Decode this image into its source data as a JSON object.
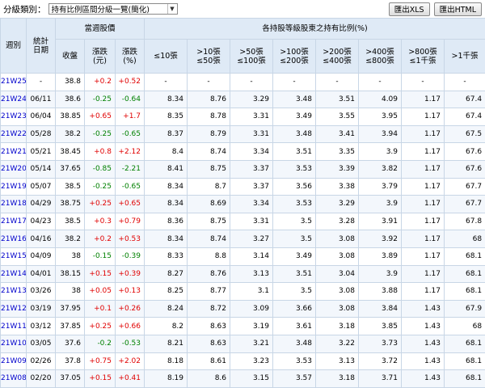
{
  "toolbar": {
    "category_label": "分級類別：",
    "category_value": "持有比例區間分級一覽(簡化)",
    "export_xls": "匯出XLS",
    "export_html": "匯出HTML"
  },
  "table": {
    "headers": {
      "week": "週別",
      "date": "統計\n日期",
      "price_group": "當週股價",
      "close": "收盤",
      "change": "漲跌\n(元)",
      "change_pct": "漲跌\n(%)",
      "holders_group": "各持股等級股東之持有比例(%)",
      "levels": [
        "≤10張",
        ">10張\n≤50張",
        ">50張\n≤100張",
        ">100張\n≤200張",
        ">200張\n≤400張",
        ">400張\n≤800張",
        ">800張\n≤1千張",
        ">1千張"
      ]
    },
    "rows": [
      {
        "week": "21W25",
        "date": "-",
        "close": "38.8",
        "change": "+0.2",
        "pct": "+0.52",
        "dir": "up",
        "levels": [
          "-",
          "-",
          "-",
          "-",
          "-",
          "-",
          "-",
          "-"
        ]
      },
      {
        "week": "21W24",
        "date": "06/11",
        "close": "38.6",
        "change": "-0.25",
        "pct": "-0.64",
        "dir": "dn",
        "levels": [
          "8.34",
          "8.76",
          "3.29",
          "3.48",
          "3.51",
          "4.09",
          "1.17",
          "67.4"
        ]
      },
      {
        "week": "21W23",
        "date": "06/04",
        "close": "38.85",
        "change": "+0.65",
        "pct": "+1.7",
        "dir": "up",
        "levels": [
          "8.35",
          "8.78",
          "3.31",
          "3.49",
          "3.55",
          "3.95",
          "1.17",
          "67.4"
        ]
      },
      {
        "week": "21W22",
        "date": "05/28",
        "close": "38.2",
        "change": "-0.25",
        "pct": "-0.65",
        "dir": "dn",
        "levels": [
          "8.37",
          "8.79",
          "3.31",
          "3.48",
          "3.41",
          "3.94",
          "1.17",
          "67.5"
        ]
      },
      {
        "week": "21W21",
        "date": "05/21",
        "close": "38.45",
        "change": "+0.8",
        "pct": "+2.12",
        "dir": "up",
        "levels": [
          "8.4",
          "8.74",
          "3.34",
          "3.51",
          "3.35",
          "3.9",
          "1.17",
          "67.6"
        ]
      },
      {
        "week": "21W20",
        "date": "05/14",
        "close": "37.65",
        "change": "-0.85",
        "pct": "-2.21",
        "dir": "dn",
        "levels": [
          "8.41",
          "8.75",
          "3.37",
          "3.53",
          "3.39",
          "3.82",
          "1.17",
          "67.6"
        ]
      },
      {
        "week": "21W19",
        "date": "05/07",
        "close": "38.5",
        "change": "-0.25",
        "pct": "-0.65",
        "dir": "dn",
        "levels": [
          "8.34",
          "8.7",
          "3.37",
          "3.56",
          "3.38",
          "3.79",
          "1.17",
          "67.7"
        ]
      },
      {
        "week": "21W18",
        "date": "04/29",
        "close": "38.75",
        "change": "+0.25",
        "pct": "+0.65",
        "dir": "up",
        "levels": [
          "8.34",
          "8.69",
          "3.34",
          "3.53",
          "3.29",
          "3.9",
          "1.17",
          "67.7"
        ]
      },
      {
        "week": "21W17",
        "date": "04/23",
        "close": "38.5",
        "change": "+0.3",
        "pct": "+0.79",
        "dir": "up",
        "levels": [
          "8.36",
          "8.75",
          "3.31",
          "3.5",
          "3.28",
          "3.91",
          "1.17",
          "67.8"
        ]
      },
      {
        "week": "21W16",
        "date": "04/16",
        "close": "38.2",
        "change": "+0.2",
        "pct": "+0.53",
        "dir": "up",
        "levels": [
          "8.34",
          "8.74",
          "3.27",
          "3.5",
          "3.08",
          "3.92",
          "1.17",
          "68"
        ]
      },
      {
        "week": "21W15",
        "date": "04/09",
        "close": "38",
        "change": "-0.15",
        "pct": "-0.39",
        "dir": "dn",
        "levels": [
          "8.33",
          "8.8",
          "3.14",
          "3.49",
          "3.08",
          "3.89",
          "1.17",
          "68.1"
        ]
      },
      {
        "week": "21W14",
        "date": "04/01",
        "close": "38.15",
        "change": "+0.15",
        "pct": "+0.39",
        "dir": "up",
        "levels": [
          "8.27",
          "8.76",
          "3.13",
          "3.51",
          "3.04",
          "3.9",
          "1.17",
          "68.1"
        ]
      },
      {
        "week": "21W13",
        "date": "03/26",
        "close": "38",
        "change": "+0.05",
        "pct": "+0.13",
        "dir": "up",
        "levels": [
          "8.25",
          "8.77",
          "3.1",
          "3.5",
          "3.08",
          "3.88",
          "1.17",
          "68.1"
        ]
      },
      {
        "week": "21W12",
        "date": "03/19",
        "close": "37.95",
        "change": "+0.1",
        "pct": "+0.26",
        "dir": "up",
        "levels": [
          "8.24",
          "8.72",
          "3.09",
          "3.66",
          "3.08",
          "3.84",
          "1.43",
          "67.9"
        ]
      },
      {
        "week": "21W11",
        "date": "03/12",
        "close": "37.85",
        "change": "+0.25",
        "pct": "+0.66",
        "dir": "up",
        "levels": [
          "8.2",
          "8.63",
          "3.19",
          "3.61",
          "3.18",
          "3.85",
          "1.43",
          "68"
        ]
      },
      {
        "week": "21W10",
        "date": "03/05",
        "close": "37.6",
        "change": "-0.2",
        "pct": "-0.53",
        "dir": "dn",
        "levels": [
          "8.21",
          "8.63",
          "3.21",
          "3.48",
          "3.22",
          "3.73",
          "1.43",
          "68.1"
        ]
      },
      {
        "week": "21W09",
        "date": "02/26",
        "close": "37.8",
        "change": "+0.75",
        "pct": "+2.02",
        "dir": "up",
        "levels": [
          "8.18",
          "8.61",
          "3.23",
          "3.53",
          "3.13",
          "3.72",
          "1.43",
          "68.1"
        ]
      },
      {
        "week": "21W08",
        "date": "02/20",
        "close": "37.05",
        "change": "+0.15",
        "pct": "+0.41",
        "dir": "up",
        "levels": [
          "8.19",
          "8.6",
          "3.15",
          "3.57",
          "3.18",
          "3.71",
          "1.43",
          "68.1"
        ]
      }
    ]
  },
  "colors": {
    "up": "#e00000",
    "down": "#008000",
    "link": "#0000cc",
    "header_bg": "#dfeaf6"
  }
}
